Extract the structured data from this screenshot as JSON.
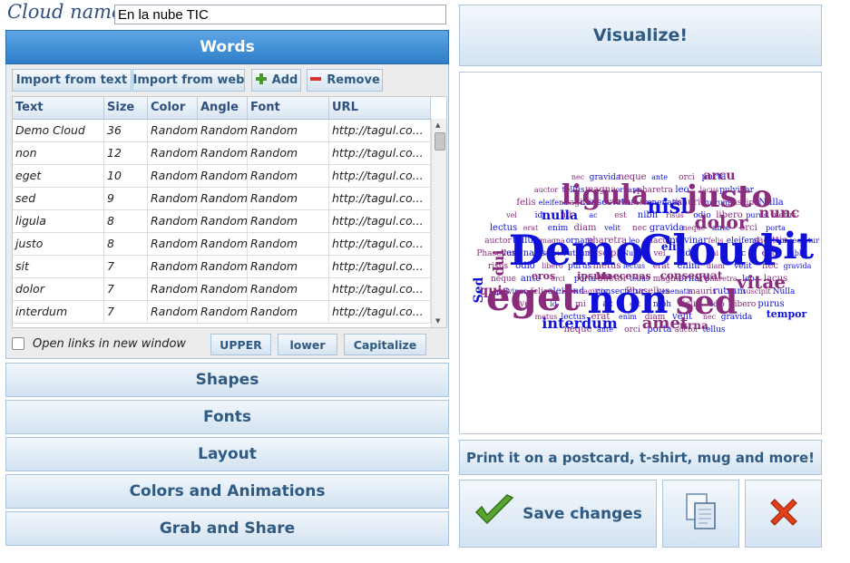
{
  "cloud_name": {
    "label": "Cloud name",
    "value": "En la nube TIC"
  },
  "panels": {
    "words": "Words",
    "shapes": "Shapes",
    "fonts": "Fonts",
    "layout": "Layout",
    "colors": "Colors and Animations",
    "grab": "Grab and Share"
  },
  "toolbar": {
    "import_text": "Import from text",
    "import_web": "Import from web",
    "add": "Add",
    "remove": "Remove"
  },
  "table": {
    "columns": [
      "Text",
      "Size",
      "Color",
      "Angle",
      "Font",
      "URL"
    ],
    "rows": [
      [
        "Demo Cloud",
        "36",
        "Random",
        "Random",
        "Random",
        "http://tagul.co..."
      ],
      [
        "non",
        "12",
        "Random",
        "Random",
        "Random",
        "http://tagul.co..."
      ],
      [
        "eget",
        "10",
        "Random",
        "Random",
        "Random",
        "http://tagul.co..."
      ],
      [
        "sed",
        "9",
        "Random",
        "Random",
        "Random",
        "http://tagul.co..."
      ],
      [
        "ligula",
        "8",
        "Random",
        "Random",
        "Random",
        "http://tagul.co..."
      ],
      [
        "justo",
        "8",
        "Random",
        "Random",
        "Random",
        "http://tagul.co..."
      ],
      [
        "sit",
        "7",
        "Random",
        "Random",
        "Random",
        "http://tagul.co..."
      ],
      [
        "dolor",
        "7",
        "Random",
        "Random",
        "Random",
        "http://tagul.co..."
      ],
      [
        "interdum",
        "7",
        "Random",
        "Random",
        "Random",
        "http://tagul.co..."
      ]
    ]
  },
  "options": {
    "open_links": "Open links in new window",
    "upper": "UPPER",
    "lower": "lower",
    "capitalize": "Capitalize"
  },
  "right": {
    "visualize": "Visualize!",
    "print": "Print it on a postcard, t-shirt, mug and more!",
    "save": "Save changes"
  },
  "cloud_words": {
    "big": [
      "Demo",
      "Cloud",
      "sit",
      "eget",
      "non",
      "sed",
      "ligula",
      "justo",
      "nisl",
      "dolor",
      "vitae",
      "amet",
      "interdum",
      "nulla",
      "dui",
      "quis",
      "arcu",
      "nunc",
      "elit",
      "Sed",
      "urna",
      "tempor",
      "Maecenas",
      "ipsum",
      "consequat",
      "eros"
    ],
    "small": [
      "nec",
      "gravida",
      "neque",
      "ante",
      "orci",
      "porta",
      "auctor",
      "tellus",
      "magna",
      "ornare",
      "pharetra",
      "leo",
      "lacus",
      "pulvinar",
      "felis",
      "eleifend",
      "sagittis",
      "consectetur",
      "Phasellus",
      "venenatis",
      "mauris",
      "rutrum",
      "suscipit",
      "Nulla",
      "vel",
      "id",
      "mi",
      "ac",
      "est",
      "nibh",
      "risus",
      "odio",
      "libero",
      "purus",
      "metus",
      "lectus",
      "erat",
      "enim",
      "diam",
      "velit"
    ]
  },
  "colors": {
    "accent": "#2e7ec8",
    "cloud_blue": "#1010d8",
    "cloud_purple": "#8a2b7c"
  }
}
